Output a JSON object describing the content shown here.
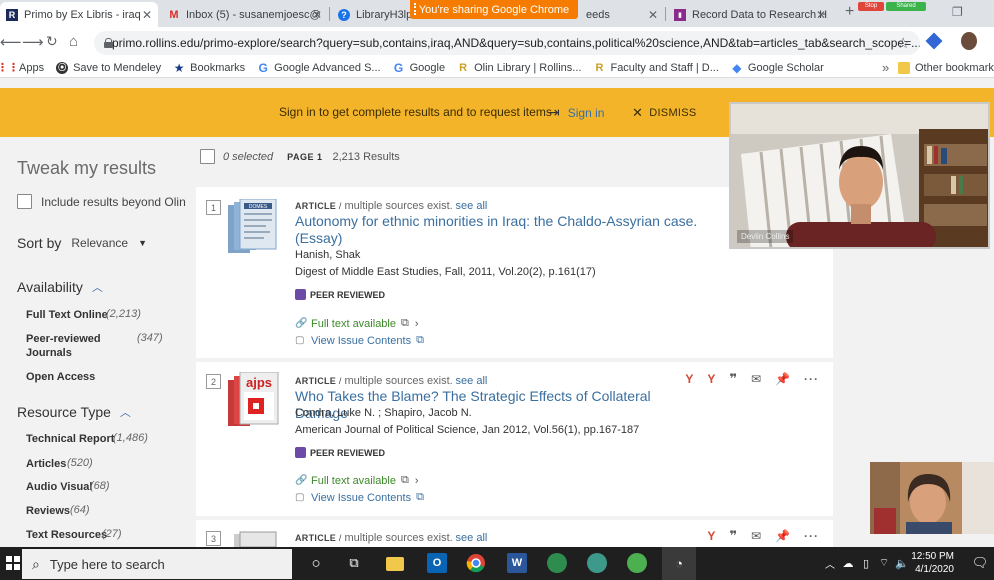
{
  "browser": {
    "tabs": [
      {
        "title": "Primo by Ex Libris - iraq",
        "fav": "R",
        "fav_color": "#1a2a5a"
      },
      {
        "title": "Inbox (5) - susanemjoesc@",
        "fav": "M",
        "fav_color": "#d93025"
      },
      {
        "title": "LibraryH3lp",
        "fav": "?",
        "fav_color": "#1a73e8"
      },
      {
        "title": "eeds",
        "fav": "",
        "fav_color": "#bbbbbb"
      },
      {
        "title": "Record Data to Research H",
        "fav": "▮",
        "fav_color": "#8b2c8c"
      }
    ],
    "sharing_label": "You're sharing Google Chrome",
    "stop_label": "Stop",
    "shared_label": "Shared",
    "url": "primo.rollins.edu/primo-explore/search?query=sub,contains,iraq,AND&query=sub,contains,political%20science,AND&tab=articles_tab&search_scope=..."
  },
  "bookmarks": [
    {
      "label": "Apps",
      "icon": "apps-grid-icon"
    },
    {
      "label": "Save to Mendeley",
      "icon": "mendeley-icon"
    },
    {
      "label": "Bookmarks",
      "icon": "star-icon"
    },
    {
      "label": "Google Advanced S...",
      "icon": "google-icon"
    },
    {
      "label": "Google",
      "icon": "google-icon"
    },
    {
      "label": "Olin Library | Rollins...",
      "icon": "rollins-icon"
    },
    {
      "label": "Faculty and Staff | D...",
      "icon": "rollins-icon"
    },
    {
      "label": "Google Scholar",
      "icon": "scholar-icon"
    }
  ],
  "bookmarks_overflow": "»",
  "bookmarks_other": "Other bookmarks",
  "banner": {
    "message": "Sign in to get complete results and to request items",
    "signin": "Sign in",
    "dismiss": "DISMISS",
    "color": "#f3b42a"
  },
  "facets": {
    "title": "Tweak my results",
    "include_beyond": "Include results beyond Olin",
    "sort_label": "Sort by",
    "sort_value": "Relevance",
    "availability": {
      "heading": "Availability",
      "items": [
        {
          "label": "Full Text Online",
          "count": "(2,213)"
        },
        {
          "label": "Peer-reviewed Journals",
          "count": "(347)"
        },
        {
          "label": "Open Access",
          "count": ""
        }
      ]
    },
    "resource_type": {
      "heading": "Resource Type",
      "items": [
        {
          "label": "Technical Report",
          "count": "(1,486)"
        },
        {
          "label": "Articles",
          "count": "(520)"
        },
        {
          "label": "Audio Visual",
          "count": "(68)"
        },
        {
          "label": "Reviews",
          "count": "(64)"
        },
        {
          "label": "Text Resources",
          "count": "(27)"
        }
      ]
    }
  },
  "results_header": {
    "selected": "0 selected",
    "page": "PAGE 1",
    "count": "2,213 Results"
  },
  "results": [
    {
      "num": "1",
      "type": "ARTICLE",
      "multi": "multiple sources exist.",
      "see_all": "see all",
      "title": "Autonomy for ethnic minorities in Iraq: the Chaldo-Assyrian case. (Essay)",
      "author": "Hanish, Shak",
      "source": "Digest of Middle East Studies, Fall, 2011, Vol.20(2), p.161(17)",
      "peer": "PEER REVIEWED",
      "fulltext": "Full text available",
      "issue": "View Issue Contents",
      "thumb_label": "DOMES"
    },
    {
      "num": "2",
      "type": "ARTICLE",
      "multi": "multiple sources exist.",
      "see_all": "see all",
      "title": "Who Takes the Blame? The Strategic Effects of Collateral Damage",
      "author": "Condra, Luke N. ; Shapiro, Jacob N.",
      "source": "American Journal of Political Science, Jan 2012, Vol.56(1), pp.167-187",
      "peer": "PEER REVIEWED",
      "fulltext": "Full text available",
      "issue": "View Issue Contents",
      "thumb_label": "ajps"
    },
    {
      "num": "3",
      "type": "ARTICLE",
      "multi": "multiple sources exist.",
      "see_all": "see all"
    }
  ],
  "video": {
    "participant_name": "Devlin Collins"
  },
  "taskbar": {
    "search_placeholder": "Type here to search",
    "time": "12:50 PM",
    "date": "4/1/2020"
  }
}
